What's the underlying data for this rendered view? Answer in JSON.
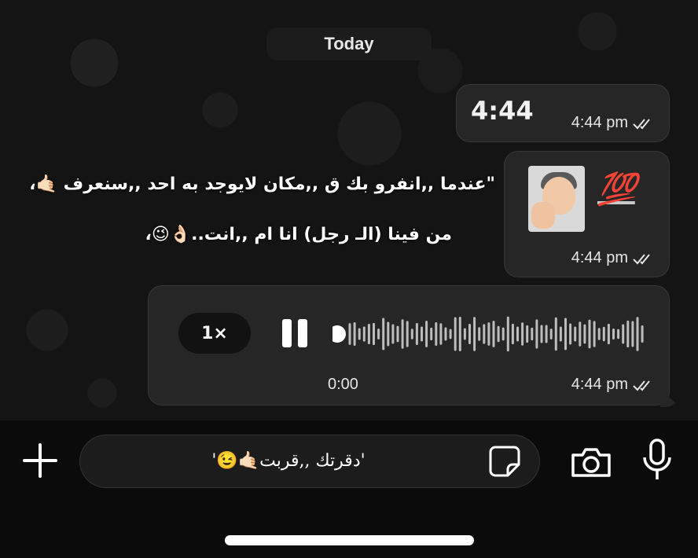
{
  "chat": {
    "date_label": "Today",
    "messages": [
      {
        "id": "m1",
        "text": "4:44",
        "time": "4:44 pm",
        "status": "read"
      },
      {
        "id": "m2",
        "sticker_label": "💯",
        "time": "4:44 pm",
        "status": "read"
      },
      {
        "id": "m3",
        "line1": "\"عندما ,,انفرو بك ق ,,مكان لايوجد به احد ,,سنعرف 🤙🏻،",
        "line2": "من فينا (الـ رجل) انا ام ,,انت..👌🏻😉،",
        "time": ""
      },
      {
        "id": "m4",
        "speed": "1×",
        "elapsed": "0:00",
        "time": "4:44 pm",
        "status": "read"
      }
    ]
  },
  "composer": {
    "input_value": "'دقرتك ,,قربت🤙🏻😉'"
  },
  "colors": {
    "bubble": "#262626",
    "background": "#141414",
    "accent": "#ffffff"
  }
}
